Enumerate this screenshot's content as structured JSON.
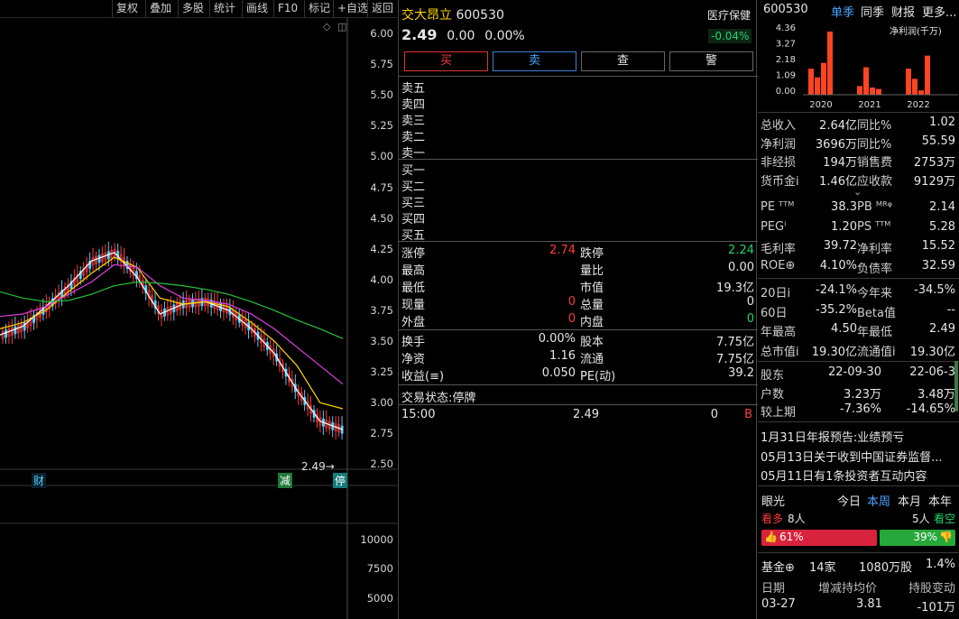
{
  "toolbar": [
    "复权",
    "叠加",
    "多股",
    "统计",
    "画线",
    "F10",
    "标记",
    "+自选",
    "返回"
  ],
  "chart": {
    "price_ticks": [
      "6.00",
      "5.75",
      "5.50",
      "5.25",
      "5.00",
      "4.75",
      "4.50",
      "4.25",
      "4.00",
      "3.75",
      "3.50",
      "3.25",
      "3.00",
      "2.75",
      "2.50"
    ],
    "last_price_label": "2.49",
    "markers": [
      "财",
      "减",
      "停"
    ],
    "volume_ticks": [
      "10000",
      "7500",
      "5000"
    ]
  },
  "stock": {
    "name": "交大昂立",
    "code": "600530",
    "sector": "医疗保健",
    "sector_change": "-0.04%",
    "price": "2.49",
    "change": "0.00",
    "change_pct": "0.00%"
  },
  "actions": {
    "buy": "买",
    "sell": "卖",
    "check": "查",
    "alert": "警"
  },
  "orderbook": {
    "asks": [
      "卖五",
      "卖四",
      "卖三",
      "卖二",
      "卖一"
    ],
    "bids": [
      "买一",
      "买二",
      "买三",
      "买四",
      "买五"
    ]
  },
  "quote": {
    "limit_up_label": "涨停",
    "limit_up": "2.74",
    "limit_down_label": "跌停",
    "limit_down": "2.24",
    "high_label": "最高",
    "vol_ratio_label": "量比",
    "vol_ratio": "0.00",
    "low_label": "最低",
    "mktcap_label": "市值",
    "mktcap": "19.3亿",
    "cur_label": "现量",
    "cur": "0",
    "total_label": "总量",
    "total": "0",
    "outer_label": "外盘",
    "outer": "0",
    "inner_label": "内盘",
    "inner": "0",
    "turnover_label": "换手",
    "turnover": "0.00%",
    "shares_label": "股本",
    "shares": "7.75亿",
    "nav_label": "净资",
    "nav": "1.16",
    "float_label": "流通",
    "float": "7.75亿",
    "eps_label": "收益(≡)",
    "eps": "0.050",
    "pe_label": "PE(动)",
    "pe": "39.2",
    "status_label": "交易状态:",
    "status": "停牌",
    "tick_time": "15:00",
    "tick_price": "2.49",
    "tick_vol": "0",
    "tick_side": "B"
  },
  "right": {
    "code": "600530",
    "tabs": [
      "单季",
      "同季",
      "财报",
      "更多"
    ],
    "mini_chart_title": "净利润(千万)",
    "mini_y": [
      "4.36",
      "3.27",
      "2.18",
      "1.09",
      "0.00"
    ],
    "mini_years": [
      "2020",
      "2021",
      "2022"
    ],
    "mini_values": [
      1.8,
      1.2,
      2.2,
      4.36,
      0.6,
      1.9,
      0.5,
      0.4,
      1.8,
      1.1,
      0.3,
      2.7
    ],
    "fin": [
      [
        "总收入",
        "2.64亿",
        "同比%",
        "1.02"
      ],
      [
        "净利润",
        "3696万",
        "同比%",
        "55.59"
      ],
      [
        "非经损",
        "194万",
        "销售费",
        "2753万"
      ],
      [
        "货币金i",
        "1.46亿",
        "应收款",
        "9129万"
      ]
    ],
    "val": [
      [
        "PE ᵀᵀᴹ",
        "38.3",
        "PB ᴹᴿᵠ",
        "2.14"
      ],
      [
        "PEGⁱ",
        "1.20",
        "PS ᵀᵀᴹ",
        "5.28"
      ],
      [
        "毛利率",
        "39.72",
        "净利率",
        "15.52"
      ],
      [
        "ROE⊕",
        "4.10%",
        "负债率",
        "32.59"
      ]
    ],
    "perf": [
      [
        "20日i",
        "-24.1%",
        "今年来",
        "-34.5%"
      ],
      [
        "60日",
        "-35.2%",
        "Beta值",
        "--"
      ],
      [
        "年最高",
        "4.50",
        "年最低",
        "2.49"
      ],
      [
        "总市值i",
        "19.30亿",
        "流通值i",
        "19.30亿"
      ]
    ],
    "holders": [
      [
        "股东",
        "22-09-30",
        "22-06-3"
      ],
      [
        "户数",
        "3.23万",
        "3.48万"
      ],
      [
        "较上期",
        "-7.36%",
        "-14.65%"
      ]
    ],
    "news": [
      "1月31日年报预告:业绩预亏",
      "05月13日关于收到中国证券监督...",
      "05月11日有1条投资者互动内容"
    ],
    "sentiment_title": "眼光",
    "sentiment_tabs": [
      "今日",
      "本周",
      "本月",
      "本年"
    ],
    "bull_label": "看多",
    "bull_count": "8人",
    "bear_count": "5人",
    "bear_label": "看空",
    "bull_pct": "61%",
    "bear_pct": "39%",
    "fund_label": "基金⊕",
    "fund_count": "14家",
    "fund_shares": "1080万股",
    "fund_pct": "1.4%",
    "hold_head": [
      "日期",
      "增减持均价",
      "持股变动"
    ],
    "hold_row": [
      "03-27",
      "3.81",
      "-101万"
    ]
  },
  "chart_data": {
    "type": "line",
    "title": "",
    "ylim": [
      2.5,
      6.0
    ],
    "series": [
      {
        "values": [
          3.55,
          3.62,
          3.78,
          3.95,
          4.15,
          4.22,
          4.02,
          3.72,
          3.8,
          3.82,
          3.75,
          3.6,
          3.4,
          3.1,
          2.85,
          2.78
        ]
      },
      {
        "values": [
          3.6,
          3.65,
          3.75,
          3.9,
          4.05,
          4.18,
          4.1,
          3.85,
          3.8,
          3.82,
          3.78,
          3.65,
          3.5,
          3.3,
          3.0,
          2.95
        ]
      },
      {
        "values": [
          3.7,
          3.72,
          3.78,
          3.88,
          3.98,
          4.12,
          4.1,
          3.95,
          3.85,
          3.83,
          3.8,
          3.72,
          3.6,
          3.45,
          3.3,
          3.15
        ]
      },
      {
        "values": [
          3.9,
          3.85,
          3.82,
          3.83,
          3.88,
          3.95,
          3.98,
          3.97,
          3.95,
          3.92,
          3.88,
          3.82,
          3.75,
          3.67,
          3.6,
          3.52
        ]
      }
    ]
  }
}
